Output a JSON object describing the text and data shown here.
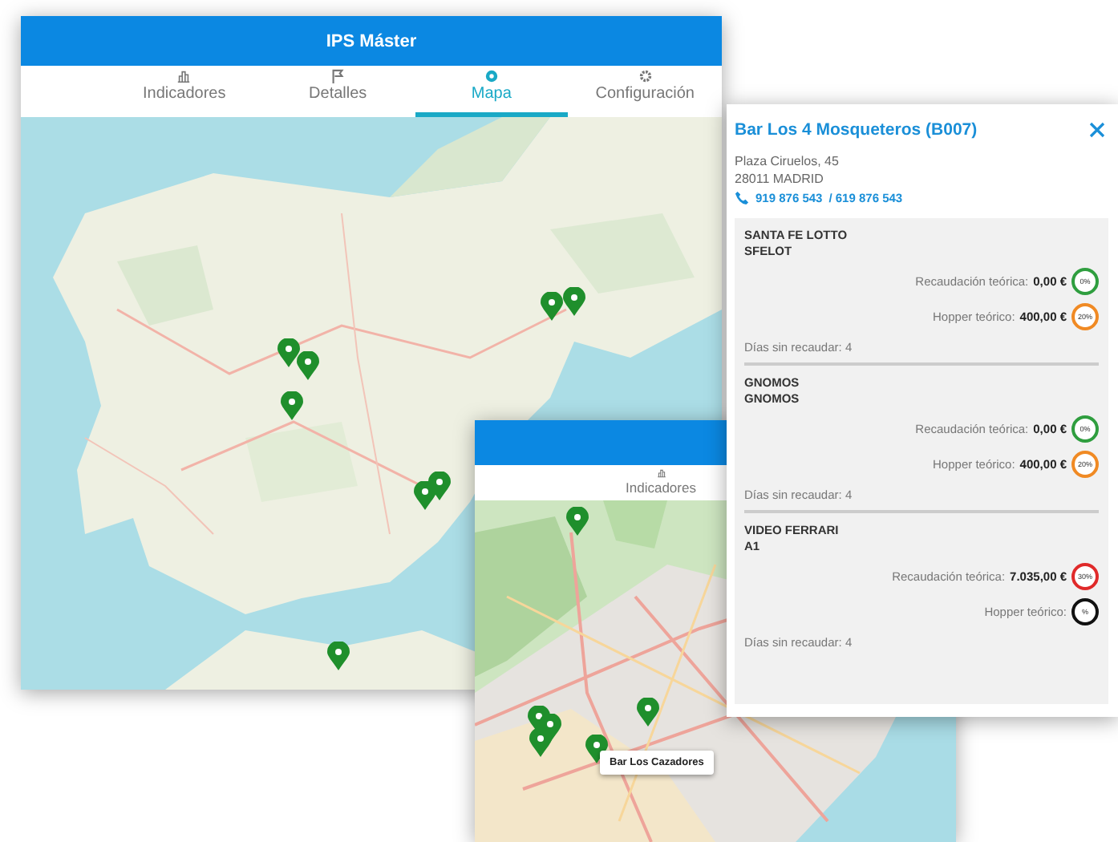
{
  "main_window": {
    "title": "IPS Máster",
    "tabs": [
      {
        "label": "Indicadores",
        "selected": false
      },
      {
        "label": "Detalles",
        "selected": false
      },
      {
        "label": "Mapa",
        "selected": true
      },
      {
        "label": "Configuración",
        "selected": false
      }
    ]
  },
  "city_window": {
    "tabs": [
      {
        "label": "Indicadores",
        "selected": false
      }
    ],
    "tooltip": "Bar Los Cazadores"
  },
  "detail_panel": {
    "title": "Bar Los 4 Mosqueteros (B007)",
    "address": [
      "Plaza Ciruelos, 45",
      "28011 MADRID"
    ],
    "phones": [
      "919 876 543",
      "/ 619 876 543"
    ],
    "machines": [
      {
        "name": "SANTA FE LOTTO",
        "code": "SFELOT",
        "rows": [
          {
            "label": "Recaudación teórica:",
            "value": "0,00 €",
            "badge": "0%",
            "color": "#2f9e3f"
          },
          {
            "label": "Hopper teórico:",
            "value": "400,00 €",
            "badge": "20%",
            "color": "#f08a24"
          }
        ],
        "days": "Días sin recaudar: 4"
      },
      {
        "name": "GNOMOS",
        "code": "GNOMOS",
        "rows": [
          {
            "label": "Recaudación teórica:",
            "value": "0,00 €",
            "badge": "0%",
            "color": "#2f9e3f"
          },
          {
            "label": "Hopper teórico:",
            "value": "400,00 €",
            "badge": "20%",
            "color": "#f08a24"
          }
        ],
        "days": "Días sin recaudar: 4"
      },
      {
        "name": "VIDEO FERRARI",
        "code": "A1",
        "rows": [
          {
            "label": "Recaudación teórica:",
            "value": "7.035,00 €",
            "badge": "30%",
            "color": "#e02a2a"
          },
          {
            "label": "Hopper teórico:",
            "badge": "%",
            "color": "#111111"
          }
        ],
        "days": "Días sin recaudar: 4"
      }
    ]
  }
}
